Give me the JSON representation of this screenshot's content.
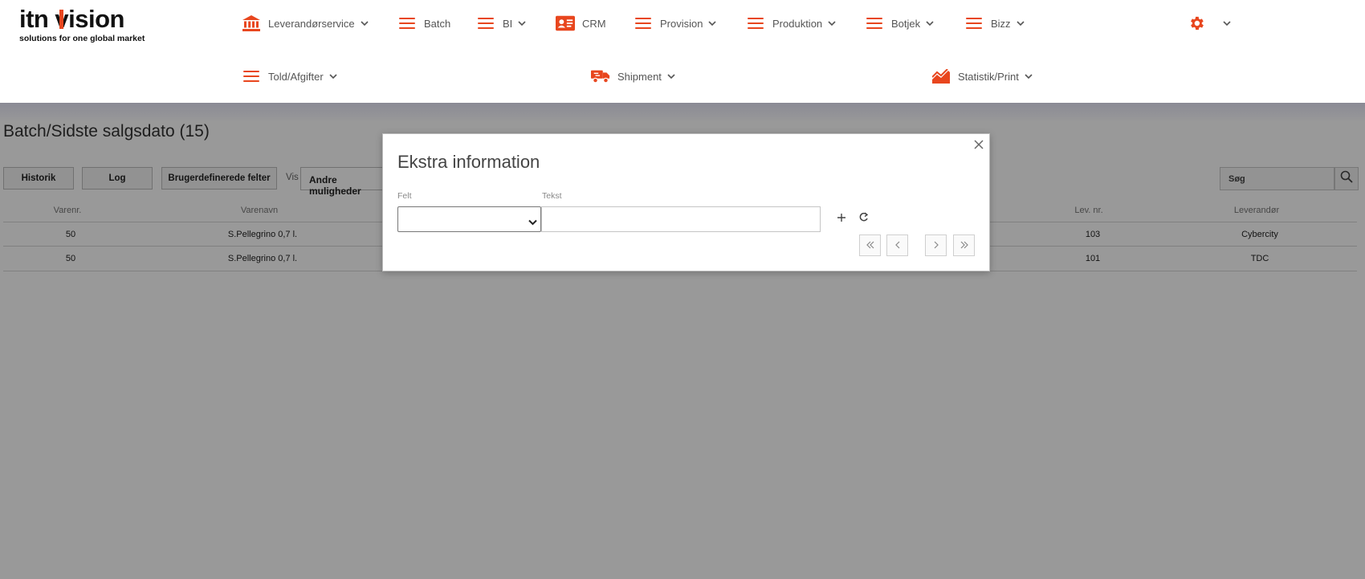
{
  "logo": {
    "wordmark": "itnvision",
    "wordmark_left": "itn",
    "wordmark_right": "vision",
    "tagline": "solutions for one global market"
  },
  "nav": {
    "row1": [
      {
        "label": "Leverandørservice",
        "icon": "bank-icon",
        "dropdown": true
      },
      {
        "label": "Batch",
        "icon": "menu-icon",
        "dropdown": false
      },
      {
        "label": "BI",
        "icon": "menu-icon",
        "dropdown": true
      },
      {
        "label": "CRM",
        "icon": "contact-card-icon",
        "dropdown": false
      },
      {
        "label": "Provision",
        "icon": "menu-icon",
        "dropdown": true
      },
      {
        "label": "Produktion",
        "icon": "menu-icon",
        "dropdown": true
      },
      {
        "label": "Botjek",
        "icon": "menu-icon",
        "dropdown": true
      },
      {
        "label": "Bizz",
        "icon": "menu-icon",
        "dropdown": true
      }
    ],
    "row2": [
      {
        "label": "Told/Afgifter",
        "icon": "menu-icon",
        "dropdown": true
      },
      {
        "label": "Shipment",
        "icon": "truck-icon",
        "dropdown": true
      },
      {
        "label": "Statistik/Print",
        "icon": "chart-icon",
        "dropdown": true
      }
    ],
    "settings_icon": "gear-icon"
  },
  "page": {
    "title": "Batch/Sidste salgsdato (15)",
    "buttons": {
      "historik": "Historik",
      "log": "Log",
      "custom_fields": "Brugerdefinerede felter"
    },
    "vis_label": "Vis",
    "vis_select": "Andre muligheder",
    "search_placeholder": "Søg",
    "columns": [
      "Varenr.",
      "Varenavn",
      "Lev. nr.",
      "Leverandør"
    ],
    "rows": [
      {
        "varenr": "50",
        "varenavn": "S.Pellegrino 0,7 l.",
        "levnr": "103",
        "leverandor": "Cybercity"
      },
      {
        "varenr": "50",
        "varenavn": "S.Pellegrino 0,7 l.",
        "levnr": "101",
        "leverandor": "TDC"
      }
    ]
  },
  "modal": {
    "title": "Ekstra information",
    "felt_label": "Felt",
    "tekst_label": "Tekst",
    "felt_value": "",
    "tekst_value": ""
  },
  "colors": {
    "accent": "#e8461e",
    "overlay": "#000000"
  }
}
